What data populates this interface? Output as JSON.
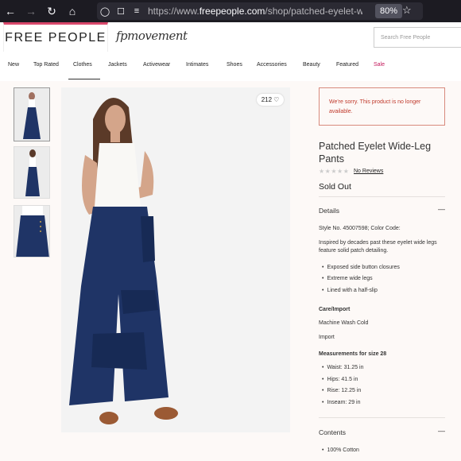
{
  "browser": {
    "url_prefix": "https://www.",
    "url_domain": "freepeople.com",
    "url_path": "/shop/patched-eyelet-wide-l",
    "zoom": "80%"
  },
  "header": {
    "logo": "FREE PEOPLE",
    "movement_logo": "fpmovement",
    "search_placeholder": "Search Free People"
  },
  "nav": {
    "items": [
      "New",
      "Top Rated",
      "Clothes",
      "Jackets",
      "Activewear",
      "Intimates",
      "Shoes",
      "Accessories",
      "Beauty",
      "Featured",
      "Sale"
    ],
    "active": "Clothes"
  },
  "product": {
    "like_count": "212",
    "alert": "We're sorry. This product is no longer available.",
    "title": "Patched Eyelet Wide-Leg Pants",
    "reviews_label": "No Reviews",
    "status": "Sold Out",
    "details": {
      "heading": "Details",
      "style_line": "Style No. 45007598; Color Code:",
      "description": "Inspired by decades past these eyelet wide legs feature solid patch detailing.",
      "features": [
        "Exposed side button closures",
        "Extreme wide legs",
        "Lined with a half-slip"
      ],
      "care_heading": "Care/Import",
      "care": "Machine Wash Cold",
      "import": "Import",
      "measurements_heading": "Measurements for size 28",
      "measurements": [
        "Waist: 31.25 in",
        "Hips: 41.5 in",
        "Rise: 12.25 in",
        "Inseam: 29 in"
      ]
    },
    "contents": {
      "heading": "Contents",
      "items": [
        "100% Cotton"
      ]
    }
  },
  "colors": {
    "brand_pink": "#d9486b",
    "sale": "#c2185b",
    "alert_text": "#c0392b",
    "pants_navy": "#1f3466"
  }
}
